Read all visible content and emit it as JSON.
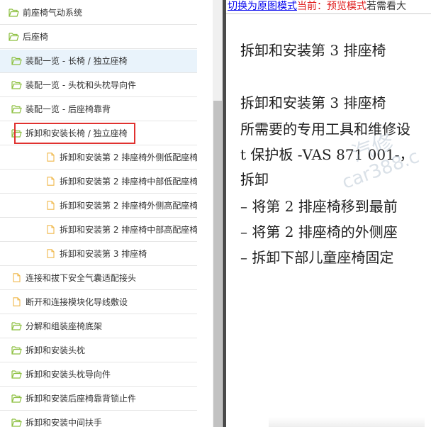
{
  "tree": {
    "selected_index": 2,
    "highlighted_index": 5,
    "items": [
      {
        "label": "前座椅气动系统",
        "icon": "folder-open-icon",
        "level": 1
      },
      {
        "label": "后座椅",
        "icon": "folder-open-icon",
        "level": 1
      },
      {
        "label": "装配一览 - 长椅 / 独立座椅",
        "icon": "folder-open-icon",
        "level": 2
      },
      {
        "label": "装配一览 - 头枕和头枕导向件",
        "icon": "folder-open-icon",
        "level": 2
      },
      {
        "label": "装配一览 - 后座椅靠背",
        "icon": "folder-open-icon",
        "level": 2
      },
      {
        "label": "拆卸和安装长椅 / 独立座椅",
        "icon": "folder-open-icon",
        "level": 2
      },
      {
        "label": "拆卸和安装第 2 排座椅外侧低配座椅",
        "icon": "document-icon",
        "level": 3
      },
      {
        "label": "拆卸和安装第 2 排座椅中部低配座椅",
        "icon": "document-icon",
        "level": 3
      },
      {
        "label": "拆卸和安装第 2 排座椅外侧高配座椅",
        "icon": "document-icon",
        "level": 3
      },
      {
        "label": "拆卸和安装第 2 排座椅中部高配座椅",
        "icon": "document-icon",
        "level": 3
      },
      {
        "label": "拆卸和安装第 3 排座椅",
        "icon": "document-icon",
        "level": 3
      },
      {
        "label": "连接和拔下安全气囊适配接头",
        "icon": "document-icon",
        "level": 2
      },
      {
        "label": "断开和连接模块化导线敷设",
        "icon": "document-icon",
        "level": 2
      },
      {
        "label": "分解和组装座椅底架",
        "icon": "folder-open-icon",
        "level": 2
      },
      {
        "label": "拆卸和安装头枕",
        "icon": "folder-open-icon",
        "level": 2
      },
      {
        "label": "拆卸和安装头枕导向件",
        "icon": "folder-open-icon",
        "level": 2
      },
      {
        "label": "拆卸和安装后座椅靠背锁止件",
        "icon": "folder-open-icon",
        "level": 2
      },
      {
        "label": "拆卸和安装中间扶手",
        "icon": "folder-open-icon",
        "level": 2
      }
    ]
  },
  "topbar": {
    "switch_link": "切换为原图模式",
    "current_mode": "当前：预览模式",
    "hint": "若需看大"
  },
  "document": {
    "title": "拆卸和安装第 3 排座椅",
    "lines": [
      "拆卸和安装第 3 排座椅",
      "所需要的专用工具和维修设",
      "t 保护板 -VAS 871 001-，",
      "拆卸",
      "– 将第 2 排座椅移到最前",
      "– 将第 2 排座椅的外侧座",
      "– 拆卸下部儿童座椅固定"
    ]
  },
  "watermark": {
    "cn": "汽修",
    "en": "car388.c"
  },
  "colors": {
    "folder": "#8cbf3f",
    "document": "#f0b94d",
    "selected_bg": "#e9f3fb",
    "highlight_border": "#e0312f",
    "link": "#0000ee",
    "mode_red": "#e02020"
  }
}
